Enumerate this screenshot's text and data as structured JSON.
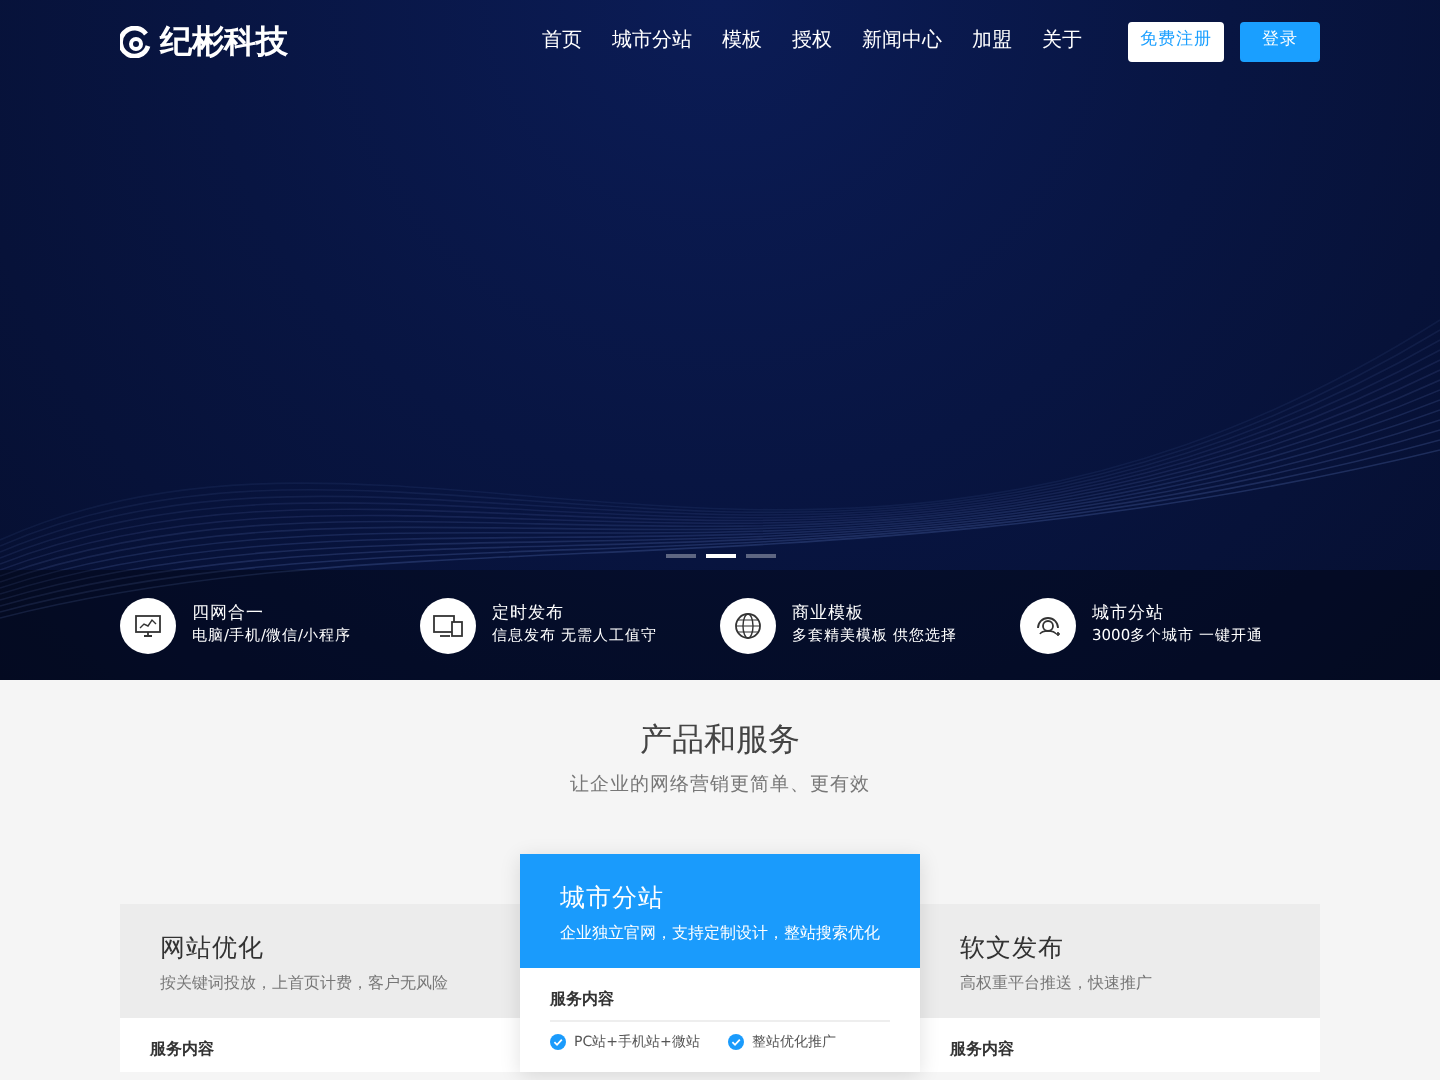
{
  "logo": {
    "text": "纪彬科技"
  },
  "nav": {
    "items": [
      {
        "label": "首页"
      },
      {
        "label": "城市分站"
      },
      {
        "label": "模板"
      },
      {
        "label": "授权"
      },
      {
        "label": "新闻中心"
      },
      {
        "label": "加盟"
      },
      {
        "label": "关于"
      }
    ],
    "buttons": [
      {
        "label": "免费注册",
        "kind": "outline"
      },
      {
        "label": "登录",
        "kind": "primary"
      }
    ]
  },
  "carousel": {
    "indicators": [
      {
        "selected": false
      },
      {
        "selected": true
      },
      {
        "selected": false
      }
    ]
  },
  "features": [
    {
      "kind": "monitor",
      "title": "四网合一",
      "subtitle": "电脑/手机/微信/小程序"
    },
    {
      "kind": "screens",
      "title": "定时发布",
      "subtitle": "信息发布 无需人工值守"
    },
    {
      "kind": "globe",
      "title": "商业模板",
      "subtitle": "多套精美模板 供您选择"
    },
    {
      "kind": "headset",
      "title": "城市分站",
      "subtitle": "3000多个城市 一键开通"
    }
  ],
  "products": {
    "title": "产品和服务",
    "subtitle": "让企业的网络营销更简单、更有效",
    "cards": [
      {
        "title": "网站优化",
        "subtitle": "按关键词投放，上首页计费，客户无风险",
        "highlighted": false,
        "section_label": "服务内容"
      },
      {
        "title": "城市分站",
        "subtitle": "企业独立官网，支持定制设计，整站搜索优化",
        "highlighted": true,
        "section_label": "服务内容",
        "items": [
          {
            "label": "PC站+手机站+微站",
            "checked": true
          },
          {
            "label": "整站优化推广",
            "checked": true
          }
        ]
      },
      {
        "title": "软文发布",
        "subtitle": "高权重平台推送，快速推广",
        "highlighted": false,
        "section_label": "服务内容"
      }
    ]
  }
}
